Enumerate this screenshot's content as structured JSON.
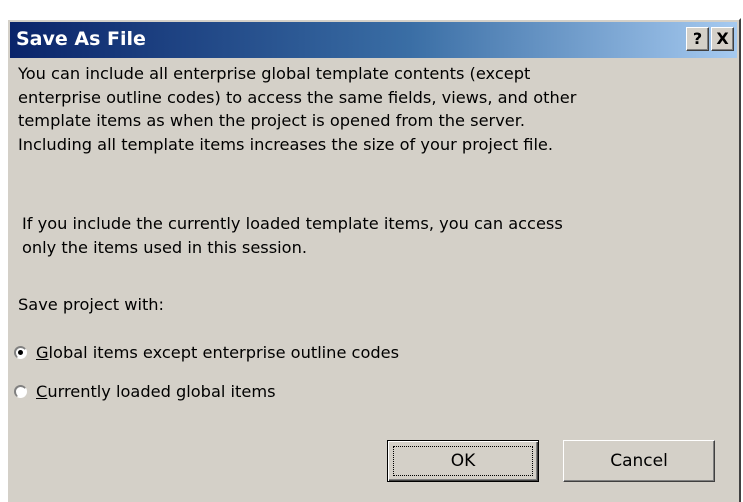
{
  "dialog": {
    "title": "Save As File",
    "help_button_label": "?",
    "close_button_label": "X"
  },
  "description": {
    "paragraph1_lines": [
      "You can include all enterprise global template contents (except",
      "enterprise outline codes) to access the same fields, views, and other",
      "template items as when the project is opened from the server.",
      "Including all template items increases the size of your project file."
    ],
    "paragraph2_lines": [
      "If you include the currently loaded template items, you can access",
      "only the items used in this session."
    ]
  },
  "save_with": {
    "label": "Save project with:",
    "options": [
      {
        "mnemonic": "G",
        "rest": "lobal items except enterprise outline codes",
        "checked": true
      },
      {
        "mnemonic": "C",
        "rest": "urrently loaded global items",
        "checked": false
      }
    ]
  },
  "buttons": {
    "ok_label": "OK",
    "cancel_label": "Cancel"
  }
}
